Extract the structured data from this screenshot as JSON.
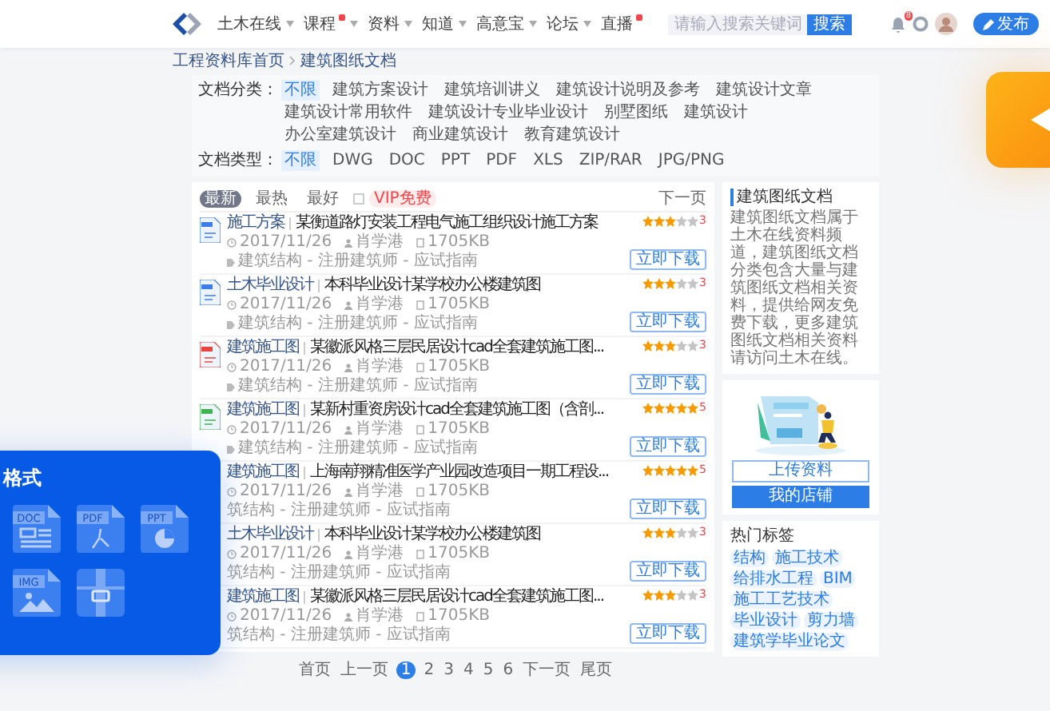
{
  "header": {
    "nav": [
      {
        "label": "土木在线",
        "dropdown": true,
        "badge": false
      },
      {
        "label": "课程",
        "dropdown": true,
        "badge": true
      },
      {
        "label": "资料",
        "dropdown": true,
        "badge": false
      },
      {
        "label": "知道",
        "dropdown": true,
        "badge": false
      },
      {
        "label": "高意宝",
        "dropdown": true,
        "badge": false
      },
      {
        "label": "论坛",
        "dropdown": true,
        "badge": false
      },
      {
        "label": "直播",
        "dropdown": false,
        "badge": true
      }
    ],
    "search": {
      "placeholder": "请输入搜索关键词",
      "button": "搜索"
    },
    "notification_count": "8",
    "publish_button": "发布"
  },
  "breadcrumb": [
    "工程资料库首页",
    "建筑图纸文档"
  ],
  "filters": [
    {
      "label": "文档分类：",
      "options": [
        {
          "label": "不限",
          "selected": true
        },
        {
          "label": "建筑方案设计",
          "selected": false
        },
        {
          "label": "建筑培训讲义",
          "selected": false
        },
        {
          "label": "建筑设计说明及参考",
          "selected": false
        },
        {
          "label": "建筑设计文章",
          "selected": false
        },
        {
          "label": "建筑设计常用软件",
          "selected": false
        },
        {
          "label": "建筑设计专业毕业设计",
          "selected": false
        },
        {
          "label": "别墅图纸",
          "selected": false
        },
        {
          "label": "建筑设计",
          "selected": false
        },
        {
          "label": "办公室建筑设计",
          "selected": false
        },
        {
          "label": "商业建筑设计",
          "selected": false
        },
        {
          "label": "教育建筑设计",
          "selected": false
        }
      ]
    },
    {
      "label": "文档类型：",
      "options": [
        {
          "label": "不限",
          "selected": true
        },
        {
          "label": "DWG",
          "selected": false
        },
        {
          "label": "DOC",
          "selected": false
        },
        {
          "label": "PPT",
          "selected": false
        },
        {
          "label": "PDF",
          "selected": false
        },
        {
          "label": "XLS",
          "selected": false
        },
        {
          "label": "ZIP/RAR",
          "selected": false
        },
        {
          "label": "JPG/PNG",
          "selected": false
        }
      ]
    }
  ],
  "list": {
    "sort_tabs": [
      {
        "label": "最新",
        "selected": true
      },
      {
        "label": "最热",
        "selected": false
      },
      {
        "label": "最好",
        "selected": false
      }
    ],
    "vip_filter": {
      "checked": false,
      "label": "VIP免费"
    },
    "next_link": "下一页",
    "items": [
      {
        "kind": "doc",
        "category": "施工方案",
        "title": "某衡道路灯安装工程电气施工组织设计施工方案",
        "date": "2017/11/26",
        "author": "肖学港",
        "size": "1705KB",
        "tag_icon": true,
        "tags": "建筑结构 - 注册建筑师 - 应试指南",
        "stars": 3,
        "rating": "3",
        "button": "立即下载"
      },
      {
        "kind": "doc",
        "category": "土木毕业设计",
        "title": "本科毕业设计某学校办公楼建筑图",
        "date": "2017/11/26",
        "author": "肖学港",
        "size": "1705KB",
        "tag_icon": true,
        "tags": "建筑结构 - 注册建筑师 - 应试指南",
        "stars": 3,
        "rating": "3",
        "button": "立即下载"
      },
      {
        "kind": "pdf",
        "category": "建筑施工图",
        "title": "某徽派风格三层民居设计cad全套建筑施工图...",
        "date": "2017/11/26",
        "author": "肖学港",
        "size": "1705KB",
        "tag_icon": true,
        "tags": "建筑结构 - 注册建筑师 - 应试指南",
        "stars": 3,
        "rating": "3",
        "button": "立即下载"
      },
      {
        "kind": "xls",
        "category": "建筑施工图",
        "title": "某新村重资房设计cad全套建筑施工图（含剖...",
        "date": "2017/11/26",
        "author": "肖学港",
        "size": "1705KB",
        "tag_icon": true,
        "tags": "建筑结构 - 注册建筑师 - 应试指南",
        "stars": 5,
        "rating": "5",
        "button": "立即下载"
      },
      {
        "category": "建筑施工图",
        "title": "上海南翔精准医学产业园改造项目一期工程设...",
        "date": "2017/11/26",
        "author": "肖学港",
        "size": "1705KB",
        "tag_icon": false,
        "tags": "筑结构 - 注册建筑师 - 应试指南",
        "stars": 5,
        "rating": "5",
        "button": "立即下载"
      },
      {
        "category": "土木毕业设计",
        "title": "本科毕业设计某学校办公楼建筑图",
        "date": "2017/11/26",
        "author": "肖学港",
        "size": "1705KB",
        "tag_icon": false,
        "tags": "筑结构 - 注册建筑师 - 应试指南",
        "stars": 3,
        "rating": "3",
        "button": "立即下载"
      },
      {
        "category": "建筑施工图",
        "title": "某徽派风格三层民居设计cad全套建筑施工图...",
        "date": "2017/11/26",
        "author": "肖学港",
        "size": "1705KB",
        "tag_icon": false,
        "tags": "筑结构 - 注册建筑师 - 应试指南",
        "stars": 3,
        "rating": "3",
        "button": "立即下载"
      }
    ]
  },
  "pagination": [
    {
      "label": "首页",
      "selected": false
    },
    {
      "label": "上一页",
      "selected": false
    },
    {
      "label": "1",
      "selected": true
    },
    {
      "label": "2",
      "selected": false
    },
    {
      "label": "3",
      "selected": false
    },
    {
      "label": "4",
      "selected": false
    },
    {
      "label": "5",
      "selected": false
    },
    {
      "label": "6",
      "selected": false
    },
    {
      "label": "下一页",
      "selected": false
    },
    {
      "label": "尾页",
      "selected": false
    }
  ],
  "sidebar": {
    "title": "建筑图纸文档",
    "description": "建筑图纸文档属于土木在线资料频道，建筑图纸文档分类包含大量与建筑图纸文档相关资料，提供给网友免费下载，更多建筑图纸文档相关资料请访问土木在线。",
    "buttons": [
      {
        "label": "上传资料",
        "kind": "outline"
      },
      {
        "label": "我的店铺",
        "kind": "solid"
      }
    ],
    "hot_tags_title": "热门标签",
    "hot_tags": [
      "结构",
      "施工技术",
      "给排水工程",
      "BIM",
      "施工工艺技术",
      "毕业设计",
      "剪力墙",
      "建筑学毕业论文"
    ]
  },
  "overlay_card": {
    "title": "格式",
    "formats": [
      {
        "kind": "blank"
      },
      {
        "kind": "doc",
        "label": "DOC"
      },
      {
        "kind": "pdf",
        "label": "PDF"
      },
      {
        "kind": "ppt",
        "label": "PPT"
      },
      {
        "kind": "blank"
      },
      {
        "kind": "img",
        "label": "IMG"
      },
      {
        "kind": "zip"
      }
    ]
  }
}
